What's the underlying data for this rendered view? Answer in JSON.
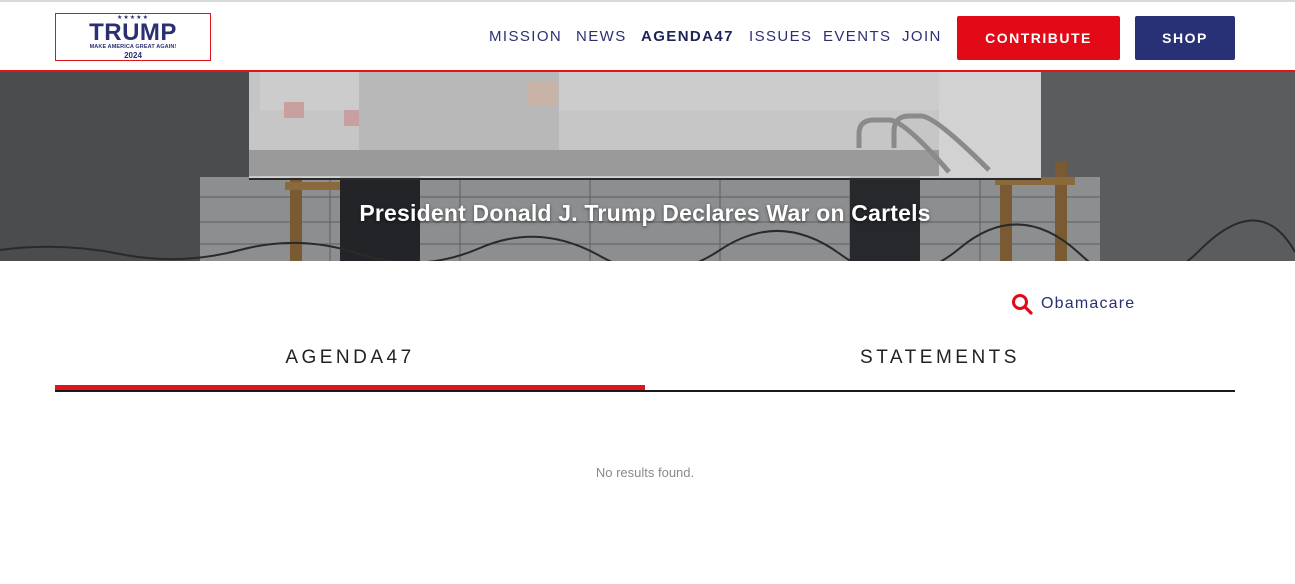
{
  "brand": {
    "stars": "★★★★★",
    "name": "TRUMP",
    "slogan": "MAKE AMERICA GREAT AGAIN!",
    "year": "2024"
  },
  "nav": {
    "items": [
      {
        "label": "MISSION"
      },
      {
        "label": "NEWS"
      },
      {
        "label": "AGENDA47",
        "active": true
      },
      {
        "label": "ISSUES"
      },
      {
        "label": "EVENTS"
      },
      {
        "label": "JOIN"
      }
    ],
    "contribute_label": "CONTRIBUTE",
    "shop_label": "SHOP"
  },
  "hero": {
    "title": "President Donald J. Trump Declares War on Cartels"
  },
  "search": {
    "icon": "search-icon",
    "term": "Obamacare"
  },
  "tabs": [
    {
      "label": "AGENDA47",
      "active": true
    },
    {
      "label": "STATEMENTS",
      "active": false
    }
  ],
  "results": {
    "empty_message": "No results found."
  },
  "colors": {
    "brand_red": "#e30a17",
    "brand_navy": "#283076",
    "text_navy": "#2b3072"
  }
}
